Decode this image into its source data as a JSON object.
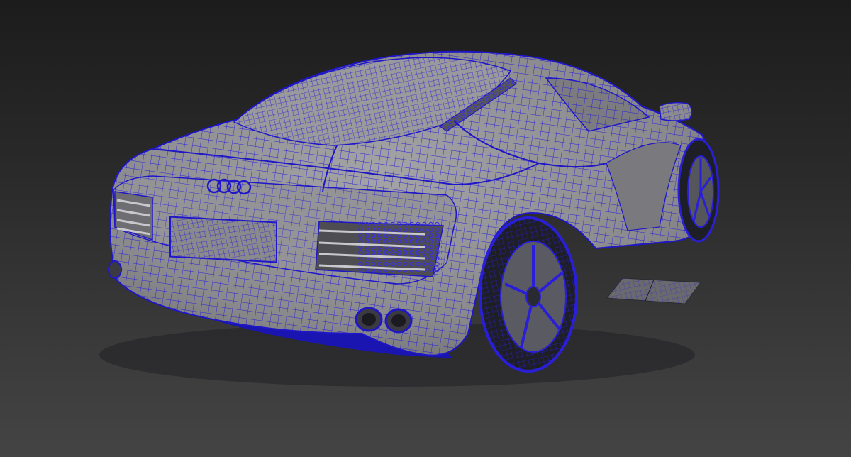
{
  "viewport": {
    "background_top": "#1c1c1c",
    "background_bottom": "#444444",
    "wire_color": "#2a1fd8",
    "surface_color": "#8f8f91"
  },
  "model": {
    "logo_text": "",
    "display_mode": "wireframe-on-shaded"
  }
}
